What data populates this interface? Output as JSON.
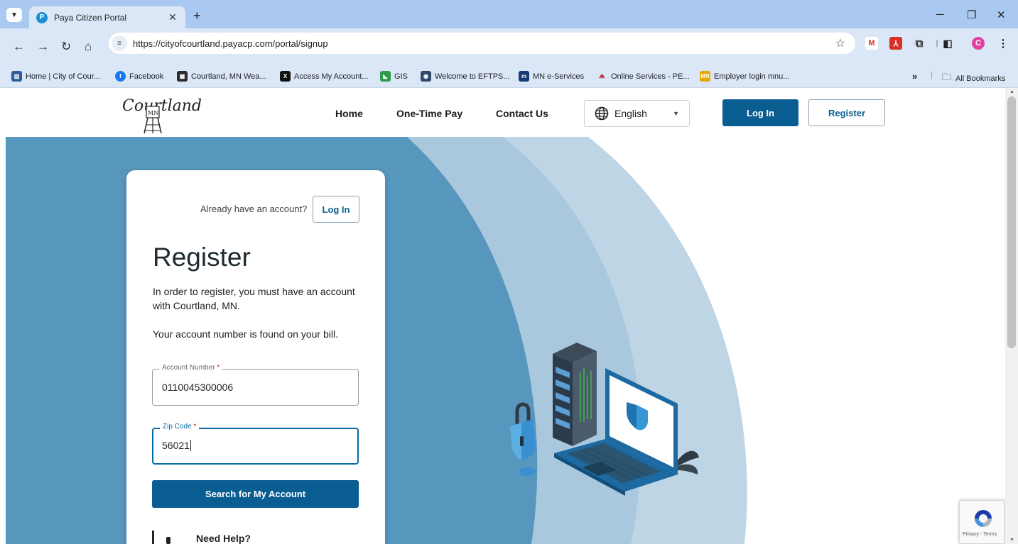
{
  "browser": {
    "tab_title": "Paya Citizen Portal",
    "tab_favicon": "P",
    "url": "https://cityofcourtland.payacp.com/portal/signup",
    "bookmarks": [
      {
        "label": "Home | City of Cour...",
        "icon": "city-hall-icon",
        "color": "#2e5c99"
      },
      {
        "label": "Facebook",
        "icon": "facebook-icon",
        "color": "#1877f2"
      },
      {
        "label": "Courtland, MN Wea...",
        "icon": "weather-icon",
        "color": "#2b2b2b"
      },
      {
        "label": "Access My Account...",
        "icon": "x-icon",
        "color": "#111111"
      },
      {
        "label": "GIS",
        "icon": "gis-icon",
        "color": "#2f9b4a"
      },
      {
        "label": "Welcome to EFTPS...",
        "icon": "eftps-icon",
        "color": "#30496b"
      },
      {
        "label": "MN e-Services",
        "icon": "mn-eservices-icon",
        "color": "#153a73"
      },
      {
        "label": "Online Services - PE...",
        "icon": "pera-icon",
        "color": "#b51f2e"
      },
      {
        "label": "Employer login mnu...",
        "icon": "employer-icon",
        "color": "#e2a800"
      }
    ],
    "all_bookmarks": "All Bookmarks",
    "overflow": "»",
    "profile_initial": "C"
  },
  "header": {
    "logo_text": "Courtland",
    "logo_badge": "MN",
    "nav": [
      "Home",
      "One-Time Pay",
      "Contact Us"
    ],
    "language": "English",
    "login_label": "Log In",
    "register_label": "Register"
  },
  "card": {
    "already_text": "Already have an account?",
    "login_label": "Log In",
    "title": "Register",
    "paragraph1": "In order to register, you must have an account with Courtland, MN.",
    "paragraph2": "Your account number is found on your bill.",
    "account_label": "Account Number",
    "account_value": "0110045300006",
    "zip_label": "Zip Code",
    "zip_value": "56021",
    "required_mark": "*",
    "search_button": "Search for My Account",
    "need_help": "Need Help?"
  },
  "recaptcha": {
    "text": "Privacy - Terms"
  },
  "colors": {
    "primary": "#095d91",
    "hero_dark": "#5796bd",
    "hero_mid": "#a9c8de",
    "hero_light": "#bed5e5"
  }
}
